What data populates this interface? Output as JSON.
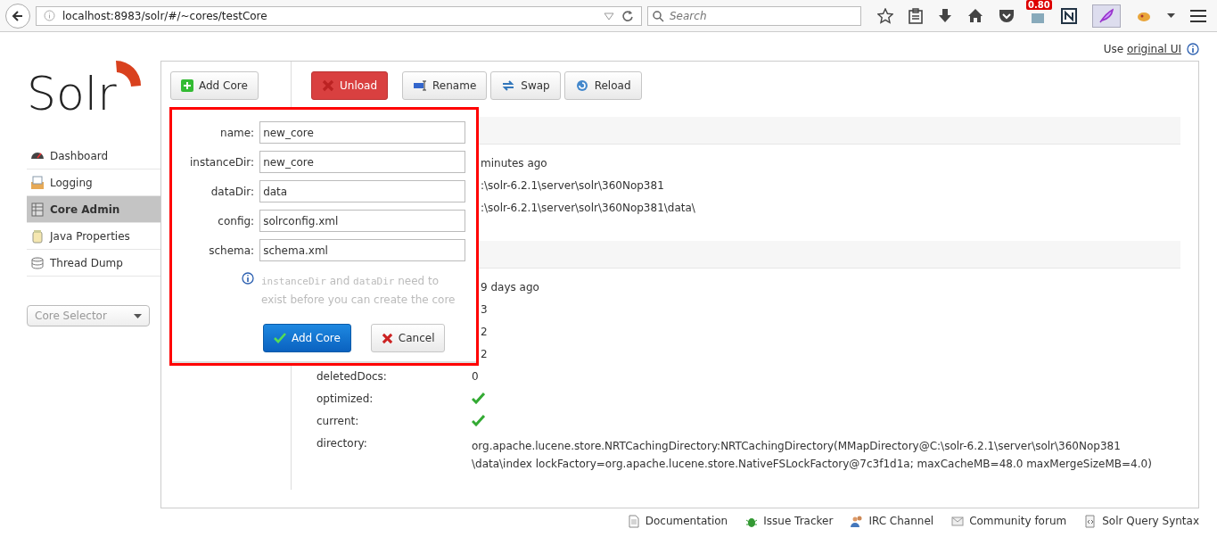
{
  "browser": {
    "url": "localhost:8983/solr/#/~cores/testCore",
    "search_placeholder": "Search",
    "badge": "0.80"
  },
  "logo": "Solr",
  "header": {
    "prefix": "Use",
    "link": "original UI"
  },
  "sidebar": {
    "items": [
      {
        "label": "Dashboard",
        "selected": false
      },
      {
        "label": "Logging",
        "selected": false
      },
      {
        "label": "Core Admin",
        "selected": true
      },
      {
        "label": "Java Properties",
        "selected": false
      },
      {
        "label": "Thread Dump",
        "selected": false
      }
    ],
    "core_selector": {
      "placeholder": "Core Selector"
    }
  },
  "toolbar": {
    "add_core": "Add Core",
    "buttons": [
      {
        "label": "Unload",
        "kind": "danger"
      },
      {
        "label": "Rename",
        "kind": "normal"
      },
      {
        "label": "Swap",
        "kind": "normal"
      },
      {
        "label": "Reload",
        "kind": "normal"
      }
    ]
  },
  "sections": [
    {
      "rows": [
        {
          "label": "",
          "kind": "text",
          "value": "minutes ago"
        },
        {
          "label": "",
          "kind": "text",
          "value": ":\\solr-6.2.1\\server\\solr\\360Nop381"
        },
        {
          "label": "",
          "kind": "text",
          "value": ":\\solr-6.2.1\\server\\solr\\360Nop381\\data\\"
        }
      ]
    },
    {
      "rows": [
        {
          "label": "",
          "kind": "text",
          "value": "9 days ago"
        },
        {
          "label": "",
          "kind": "text",
          "value": "3"
        },
        {
          "label": "",
          "kind": "text",
          "value": "2"
        },
        {
          "label": "",
          "kind": "text",
          "value": "2"
        },
        {
          "label": "deletedDocs:",
          "kind": "text",
          "value": "0"
        },
        {
          "label": "optimized:",
          "kind": "check",
          "checked": true
        },
        {
          "label": "current:",
          "kind": "check",
          "checked": true
        },
        {
          "label": "directory:",
          "kind": "lines",
          "lines": [
            "org.apache.lucene.store.NRTCachingDirectory:NRTCachingDirectory(MMapDirectory@C:\\solr-6.2.1\\server\\solr\\360Nop381",
            "\\data\\index lockFactory=org.apache.lucene.store.NativeFSLockFactory@7c3f1d1a; maxCacheMB=48.0 maxMergeSizeMB=4.0)"
          ]
        }
      ]
    }
  ],
  "popup": {
    "fields": [
      {
        "label": "name:",
        "value": "new_core"
      },
      {
        "label": "instanceDir:",
        "value": "new_core"
      },
      {
        "label": "dataDir:",
        "value": "data"
      },
      {
        "label": "config:",
        "value": "solrconfig.xml"
      },
      {
        "label": "schema:",
        "value": "schema.xml"
      }
    ],
    "note": [
      {
        "text": "instanceDir",
        "kind": "code"
      },
      {
        "text": " and ",
        "kind": "plain"
      },
      {
        "text": "dataDir",
        "kind": "code"
      },
      {
        "text": " need to exist before you can create the core",
        "kind": "plain"
      }
    ],
    "submit": "Add Core",
    "cancel": "Cancel"
  },
  "footer": {
    "links": [
      "Documentation",
      "Issue Tracker",
      "IRC Channel",
      "Community forum",
      "Solr Query Syntax"
    ]
  }
}
